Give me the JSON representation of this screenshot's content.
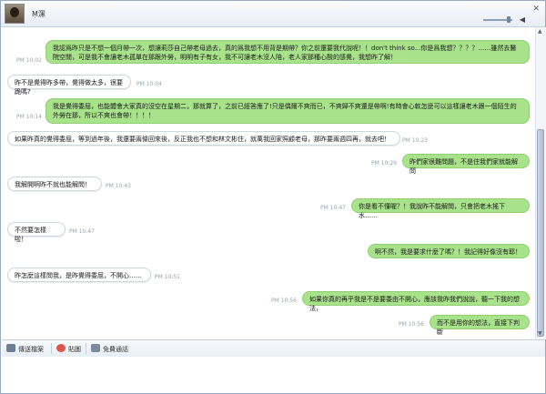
{
  "window": {
    "contact_name": "Ṃ潶"
  },
  "messages": [
    {
      "dir": "out",
      "ts": "PM 10:02",
      "text": "我認爲昨只是不想一個月帶一次，想讓莉莎自己帶老母過去，真的爲我想不用背是期帶？你之前還要我代說呢！！don't think so...你是爲我想？？？？……雖然去醫院空閒，可是我不會讓老木孤單在那跟外勞，明明有子有女，我不可讓老木沒人陪，老人家那種心酸的感覺，我想昨了解！"
    },
    {
      "dir": "in",
      "ts": "PM 10:04",
      "text": "昨不是覺得昨多帶，覺得做太多，很要跪嗎?"
    },
    {
      "dir": "out",
      "ts": "PM 10:14",
      "text": "我是覺得委屈，也能體會大家真的沒空在星期二，那就算了，之前已經答應了!只是偶爾不爽而已，不爽歸不爽還是帶啊!有時會心軟怎麼可以這樣讓老木跟一個陌生的外勞在那，所以不爽也會帶！！！！"
    },
    {
      "dir": "in",
      "ts": "PM 10:23",
      "text": "如果昨真的覺得委屈，等到過年後，我還要兩條回來後，反正我也不想和林文彬住，就萬我回家照顧老母，那昨要兩週四再，就去吧！"
    },
    {
      "dir": "out",
      "ts": "PM 10:29",
      "text": "昨們家很難問題，不是住我們家就能解問"
    },
    {
      "dir": "in",
      "ts": "PM 10:43",
      "text": "我解開啊昨不就也能解問！"
    },
    {
      "dir": "out",
      "ts": "PM 10:47",
      "text": "你是看不懂喔？！我說昨不能解問，只會把老木搖下水……"
    },
    {
      "dir": "in",
      "ts": "PM 10:47",
      "text": "不然要怎樣啦！"
    },
    {
      "dir": "out",
      "ts": "",
      "text": "啊不然，我是要求什麼了嗎？！我記得好像沒有耶！"
    },
    {
      "dir": "in",
      "ts": "PM 10:51",
      "text": "昨怎麼這樣問我，是昨覺得委屈，不開心……"
    },
    {
      "dir": "out",
      "ts": "PM 10:56",
      "text": "如果你真的再乎我是不是要委由不開心，應該我昨我們說說，聽一下我的想法，"
    },
    {
      "dir": "out",
      "ts": "PM 10:56",
      "text": "而不是用你的想法，直接下判斷"
    }
  ],
  "toolbar": {
    "send_file": "傳送檔案",
    "sticker": "貼圖",
    "free_call": "免費通話"
  }
}
